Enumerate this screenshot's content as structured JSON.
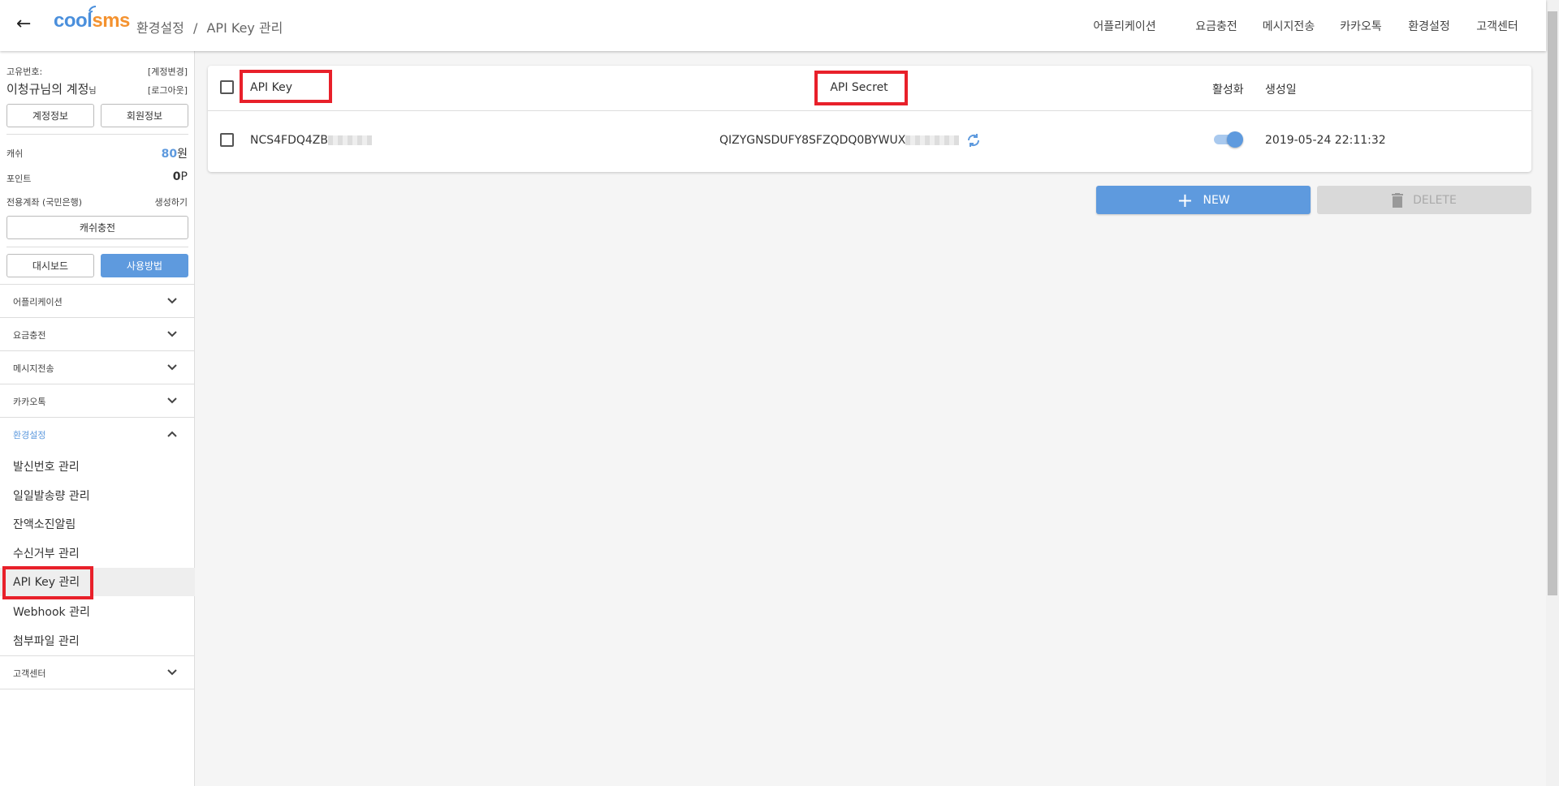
{
  "header": {
    "logo_text": "coolsms",
    "breadcrumb_parent": "환경설정",
    "breadcrumb_sep": "/",
    "breadcrumb_current": "API Key 관리",
    "nav": [
      "어플리케이션",
      "요금충전",
      "메시지전송",
      "카카오톡",
      "환경설정",
      "고객센터"
    ]
  },
  "account": {
    "id_label": "고유번호:",
    "change_account": "[계정변경]",
    "name": "이청규님의 계정",
    "name_suffix": "님",
    "logout": "[로그아웃]",
    "account_info": "계정정보",
    "member_info": "회원정보",
    "cash_label": "캐쉬",
    "cash_value": "80",
    "cash_unit": "원",
    "point_label": "포인트",
    "point_value": "0",
    "point_unit": "P",
    "bank_label": "전용계좌 (국민은행)",
    "bank_action": "생성하기",
    "charge_button": "캐쉬충전",
    "dashboard_button": "대시보드",
    "guide_button": "사용방법"
  },
  "menu": {
    "items": [
      "어플리케이션",
      "요금충전",
      "메시지전송",
      "카카오톡"
    ],
    "expanded": "환경설정",
    "sub_items": [
      "발신번호 관리",
      "일일발송량 관리",
      "잔액소진알림",
      "수신거부 관리",
      "API Key 관리",
      "Webhook 관리",
      "첨부파일 관리"
    ],
    "last": "고객센터"
  },
  "table": {
    "headers": {
      "key": "API Key",
      "secret": "API Secret",
      "active": "활성화",
      "created": "생성일"
    },
    "rows": [
      {
        "key": "NCS4FDQ4ZB",
        "secret": "QIZYGNSDUFY8SFZQDQ0BYWUX",
        "active": true,
        "created": "2019-05-24 22:11:32"
      }
    ]
  },
  "actions": {
    "new": "NEW",
    "delete": "DELETE"
  },
  "colors": {
    "accent": "#5e9ade",
    "highlight": "#e8202a"
  }
}
